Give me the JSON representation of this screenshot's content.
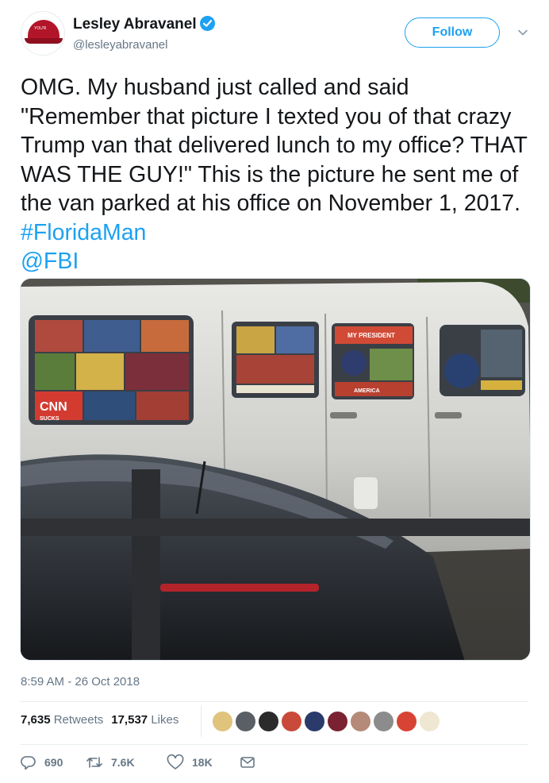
{
  "user": {
    "display_name": "Lesley Abravanel",
    "handle": "@lesleyabravanel",
    "verified_icon": "verified-badge-icon",
    "avatar_icon": "red-cap-avatar",
    "avatar_cap_text": "YOU'R"
  },
  "follow_button": {
    "label": "Follow"
  },
  "tweet": {
    "text_main": "OMG. My husband just called and said \"Remember that picture I texted you of that crazy Trump van that delivered lunch to my office? THAT WAS THE GUY!\" This is the picture he sent me of the van parked at his office on November 1, 2017. ",
    "hashtag": "#FloridaMan",
    "mention": "@FBI"
  },
  "photo": {
    "sticker_texts": {
      "cnn": "CNN",
      "sucks": "SUCKS",
      "my_president": "MY PRESIDENT",
      "america": "AMERICA"
    }
  },
  "meta": {
    "timestamp": "8:59 AM - 26 Oct 2018"
  },
  "stats": {
    "retweets_count": "7,635",
    "retweets_label": "Retweets",
    "likes_count": "17,537",
    "likes_label": "Likes",
    "liker_avatars": [
      "#e0c37c",
      "#5a5f66",
      "#2b2b2b",
      "#c94a3a",
      "#2a3a6b",
      "#7a2232",
      "#b58a78",
      "#8c8c8c",
      "#d84434",
      "#efe7d2"
    ]
  },
  "actions": {
    "reply_count": "690",
    "retweet_count": "7.6K",
    "like_count": "18K"
  },
  "colors": {
    "accent": "#1da1f2",
    "secondary_text": "#657786",
    "primary_text": "#14171a"
  }
}
